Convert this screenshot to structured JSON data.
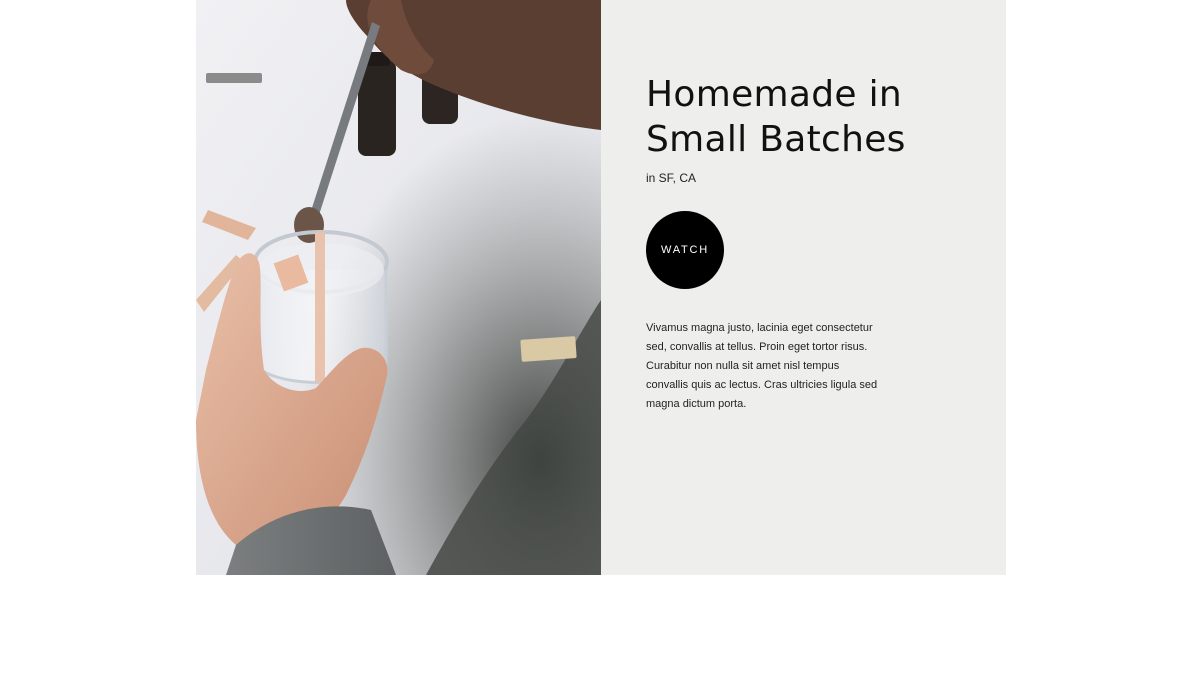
{
  "hero": {
    "title": "Homemade in Small Batches",
    "location": "in SF, CA",
    "watch_label": "WATCH",
    "description": "Vivamus magna justo, lacinia eget consectetur sed, convallis at tellus. Proin eget tortor risus. Curabitur non nulla sit amet nisl tempus convallis quis ac lectus. Cras ultricies ligula sed magna dictum porta."
  },
  "colors": {
    "panel_background": "#eeefed",
    "button_background": "#000000",
    "button_text": "#ffffff",
    "text": "#111111"
  },
  "icons": {
    "photo": "candle-making-photo"
  }
}
